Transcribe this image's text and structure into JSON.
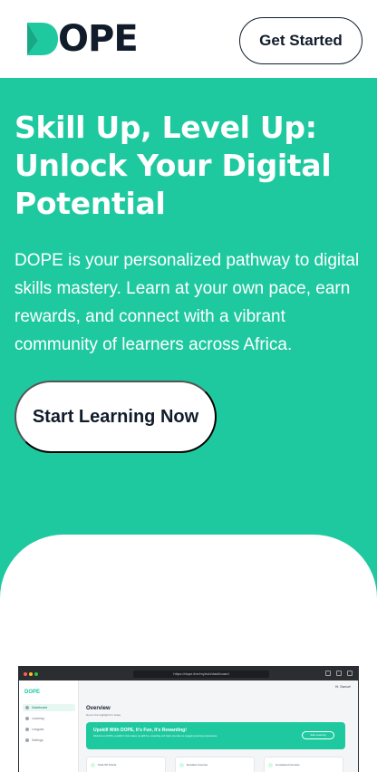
{
  "header": {
    "logo_text": "OPE",
    "logo_alt": "DOPE",
    "cta_label": "Get Started"
  },
  "hero": {
    "title": "Skill Up, Level Up: Unlock Your Digital Potential",
    "description": "DOPE is your personalized pathway to digital skills mastery. Learn at your own pace, earn rewards, and connect with a vibrant community of learners across Africa.",
    "cta_label": "Start Learning Now"
  },
  "preview": {
    "url": "https://dope.live/myhub/dashboard",
    "logo": "DOPE",
    "sidebar": [
      "Dashboard",
      "Learning",
      "Leagues",
      "Settings"
    ],
    "user": "Hi, Samuel",
    "overview_title": "Overview",
    "overview_sub": "Here's the highlight for today",
    "banner_title": "Upskill With DOPE, It's Fun, It's Rewarding!",
    "banner_text": "Welcome to DOPE, a platform that makes up-skill fun, rewarding and helps you take on engaging learning experiences.",
    "banner_button": "Start Learning",
    "stats": [
      "Total XP Points",
      "Enrolled Courses",
      "Completed Courses"
    ]
  },
  "colors": {
    "brand_green": "#1fc9a0",
    "navy": "#111c2b",
    "white": "#ffffff"
  },
  "icons": [
    "dope-logo-mark-icon",
    "lock-icon",
    "share-icon",
    "plus-icon",
    "tabs-icon"
  ]
}
